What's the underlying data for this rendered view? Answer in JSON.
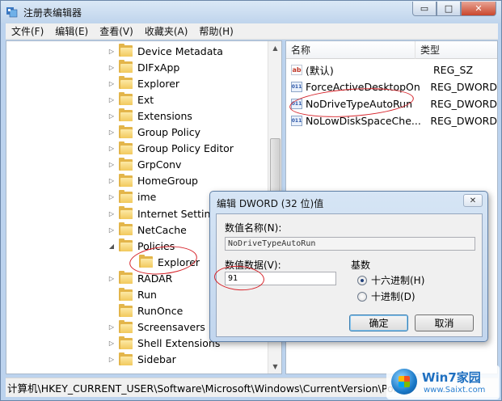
{
  "window": {
    "title": "注册表编辑器",
    "buttons": {
      "minimize": "▭",
      "maximize": "□",
      "close": "✕"
    }
  },
  "menu": [
    "文件(F)",
    "编辑(E)",
    "查看(V)",
    "收藏夹(A)",
    "帮助(H)"
  ],
  "tree": {
    "items": [
      {
        "label": "Device Metadata",
        "expander": "▷"
      },
      {
        "label": "DIFxApp",
        "expander": "▷"
      },
      {
        "label": "Explorer",
        "expander": "▷"
      },
      {
        "label": "Ext",
        "expander": "▷"
      },
      {
        "label": "Extensions",
        "expander": "▷"
      },
      {
        "label": "Group Policy",
        "expander": "▷"
      },
      {
        "label": "Group Policy Editor",
        "expander": "▷"
      },
      {
        "label": "GrpConv",
        "expander": "▷"
      },
      {
        "label": "HomeGroup",
        "expander": "▷"
      },
      {
        "label": "ime",
        "expander": "▷"
      },
      {
        "label": "Internet Settings",
        "expander": "▷"
      },
      {
        "label": "NetCache",
        "expander": "▷"
      },
      {
        "label": "Policies",
        "expander": "◢"
      },
      {
        "label": "Explorer",
        "expander": ""
      },
      {
        "label": "RADAR",
        "expander": "▷"
      },
      {
        "label": "Run",
        "expander": ""
      },
      {
        "label": "RunOnce",
        "expander": ""
      },
      {
        "label": "Screensavers",
        "expander": "▷"
      },
      {
        "label": "Shell Extensions",
        "expander": "▷"
      },
      {
        "label": "Sidebar",
        "expander": "▷"
      }
    ],
    "scroll": {
      "up": "▲",
      "down": "▼"
    }
  },
  "list": {
    "columns": {
      "name": "名称",
      "type": "类型"
    },
    "rows": [
      {
        "icon": "ab",
        "name": "(默认)",
        "type": "REG_SZ"
      },
      {
        "icon": "011",
        "name": "ForceActiveDesktopOn",
        "type": "REG_DWORD"
      },
      {
        "icon": "011",
        "name": "NoDriveTypeAutoRun",
        "type": "REG_DWORD"
      },
      {
        "icon": "011",
        "name": "NoLowDiskSpaceChe...",
        "type": "REG_DWORD"
      }
    ]
  },
  "dialog": {
    "title": "编辑 DWORD (32 位)值",
    "close": "✕",
    "value_name_label": "数值名称(N):",
    "value_name": "NoDriveTypeAutoRun",
    "value_data_label": "数值数据(V):",
    "value_data": "91",
    "base_label": "基数",
    "radio_hex": "十六进制(H)",
    "radio_dec": "十进制(D)",
    "ok": "确定",
    "cancel": "取消"
  },
  "statusbar": {
    "path": "计算机\\HKEY_CURRENT_USER\\Software\\Microsoft\\Windows\\CurrentVersion\\Poli"
  },
  "watermark": {
    "brand": "Win7家园",
    "url": "www.Saixt.com"
  },
  "colors": {
    "annotation": "#d6232a",
    "folder": "#e3b54a",
    "accent": "#3c7fb1"
  }
}
